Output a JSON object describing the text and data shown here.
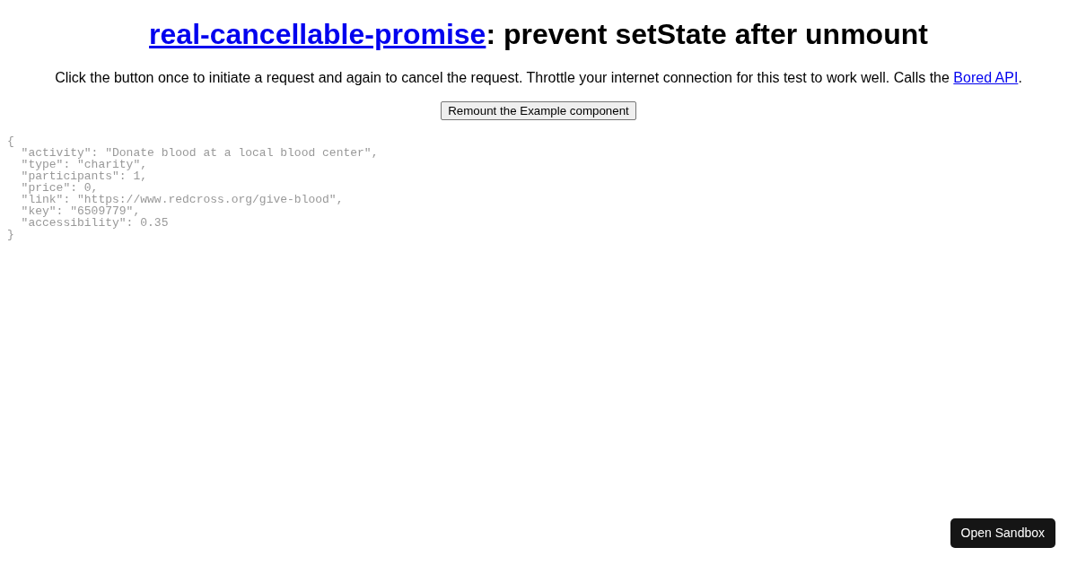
{
  "title": {
    "link": "real-cancellable-promise",
    "text": ": prevent setState after unmount"
  },
  "description": {
    "text": "Click the button once to initiate a request and again to cancel the request. Throttle your internet connection for this test to work well. Calls the ",
    "link": "Bored API",
    "trailing": "."
  },
  "remount_button": "Remount the Example component",
  "response_json": "{\n  \"activity\": \"Donate blood at a local blood center\",\n  \"type\": \"charity\",\n  \"participants\": 1,\n  \"price\": 0,\n  \"link\": \"https://www.redcross.org/give-blood\",\n  \"key\": \"6509779\",\n  \"accessibility\": 0.35\n}",
  "sandbox_button": "Open Sandbox"
}
